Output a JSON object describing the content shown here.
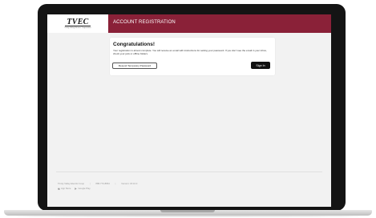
{
  "header": {
    "logo_text": "TVEC",
    "logo_subtext": "Trinity Valley Electric Cooperative",
    "title": "ACCOUNT REGISTRATION"
  },
  "card": {
    "heading": "Congratulations!",
    "message": "Your registration is almost complete. You will receive an email with instructions for setting your password. If you don't see the email in your inbox, check your junk or offline folders.",
    "resend_label": "Resend Temporary Password",
    "signin_label": "Sign In"
  },
  "footer": {
    "company": "Trinity Valley Electric Coop",
    "separator": "|",
    "phone": "888-770-8864",
    "version": "Version: 18.10.0",
    "stores": [
      "App Store",
      "Google Play"
    ]
  },
  "colors": {
    "accent": "#8a2138",
    "button_dark": "#111111",
    "background": "#f2f2f2"
  }
}
